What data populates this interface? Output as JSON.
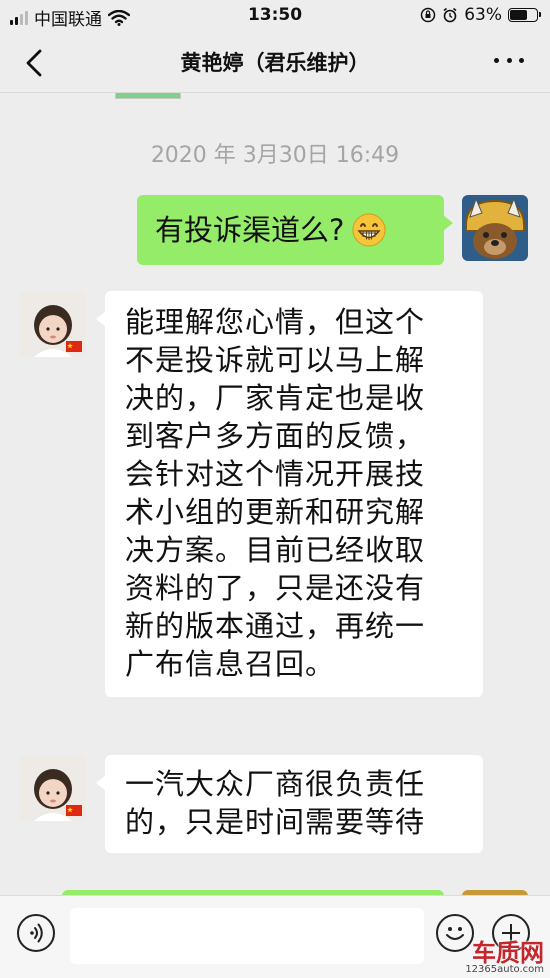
{
  "status_bar": {
    "carrier": "中国联通",
    "time": "13:50",
    "battery_percent": "63%"
  },
  "nav": {
    "title": "黄艳婷（君乐维护）"
  },
  "chat": {
    "timestamp": "2020 年 3月30日 16:49",
    "messages": [
      {
        "direction": "outgoing",
        "text": "有投诉渠道么?",
        "emoji": "grinning-face"
      },
      {
        "direction": "incoming",
        "lines": [
          "能理解您心情，但这个",
          "不是投诉就可以马上解",
          "决的，厂家肯定也是收",
          "到客户多方面的反馈，",
          "会针对这个情况开展技",
          "术小组的更新和研究解",
          "决方案。目前已经收取",
          "资料的了，只是还没有",
          "新的版本通过，再统一",
          "广布信息召回。"
        ]
      },
      {
        "direction": "incoming",
        "lines": [
          "一汽大众厂商很负责任",
          "的，只是时间需要等待"
        ]
      }
    ]
  },
  "input_bar": {
    "placeholder": ""
  },
  "watermark": {
    "main": "车质网",
    "sub": "12365auto.com"
  },
  "colors": {
    "outgoing_bubble": "#95ec69",
    "incoming_bubble": "#ffffff",
    "background": "#ededed"
  }
}
